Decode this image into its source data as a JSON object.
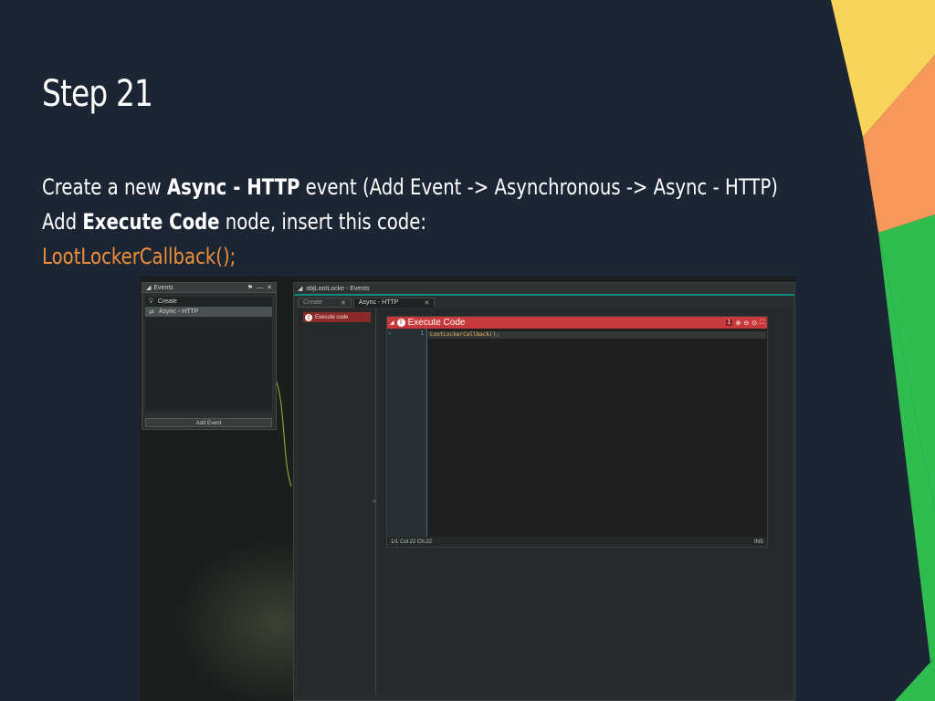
{
  "colors": {
    "background": "#1c2533",
    "accent_orange": "#f0903a",
    "deco_yellow": "#f8d55a",
    "deco_orange": "#f5985a",
    "deco_green": "#2fbd4f",
    "code_header_red": "#c8393b",
    "code_text": "#e9b35a"
  },
  "slide": {
    "title": "Step 21",
    "line1": {
      "part1": "Create a new ",
      "bold": "Async - HTTP",
      "part2": " event (Add Event -> Asynchronous -> Async - HTTP)"
    },
    "line2": {
      "part1": "Add ",
      "bold": "Execute Code",
      "part2": " node, insert this code:"
    },
    "code_line": "LootLockerCallback();"
  },
  "editor": {
    "events_panel": {
      "title": "Events",
      "items": [
        {
          "label": "Create",
          "icon": "lightbulb-icon"
        },
        {
          "label": "Async - HTTP",
          "icon": "transfer-arrows-icon"
        }
      ],
      "add_button": "Add Event"
    },
    "object_window": {
      "title": "objLootLocke - Events",
      "tabs": [
        {
          "label": "Create"
        },
        {
          "label": "Async - HTTP"
        }
      ],
      "node_label": "Execute code",
      "code_window": {
        "title": "Execute Code",
        "error_count": "1",
        "line_number": "1",
        "code": "LootLockerCallback();",
        "status_left": "1/1 Col:22 Ch:22",
        "status_right": "INS"
      }
    }
  }
}
